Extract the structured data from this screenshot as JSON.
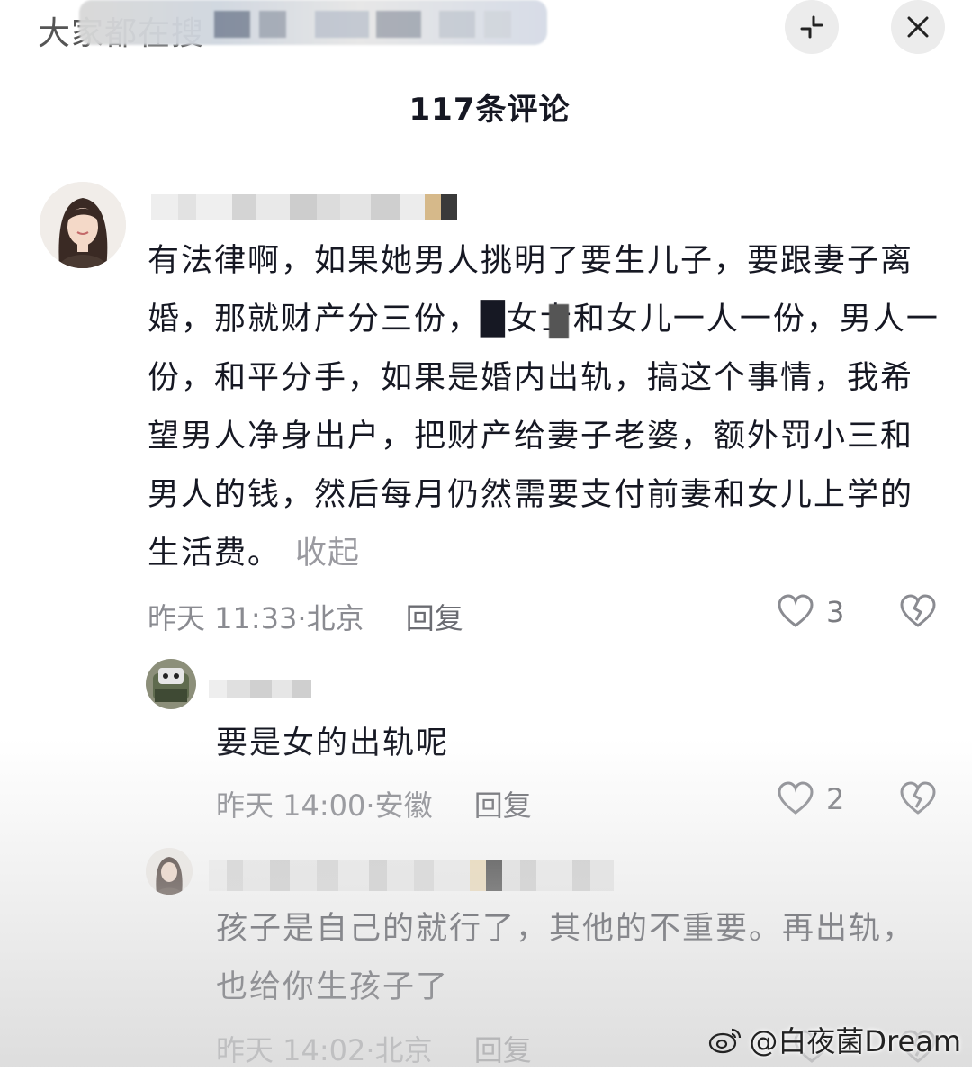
{
  "header": {
    "title_fragment": "大家都在搜",
    "comment_count": "117条评论",
    "icons": [
      "collapse-icon",
      "close-icon"
    ]
  },
  "comments": [
    {
      "text": "有法律啊，如果她男人挑明了要生儿子，要跟妻子离婚，那就财产分三份，█女士和女儿一人一份，男人一份，和平分手，如果是婚内出轨，搞这个事情，我希望男人净身出户，把财产给妻子老婆，额外罚小三和男人的钱，然后每月仍然需要支付前妻和女儿上学的生活费。",
      "collapse_label": "收起",
      "time": "昨天 11:33",
      "location": "北京",
      "reply_label": "回复",
      "likes": "3"
    },
    {
      "text": "要是女的出轨呢",
      "time": "昨天 14:00",
      "location": "安徽",
      "reply_label": "回复",
      "likes": "2"
    },
    {
      "text": "孩子是自己的就行了，其他的不重要。再出轨，也给你生孩子了",
      "time": "昨天 14:02",
      "location": "北京",
      "reply_label": "回复"
    }
  ],
  "watermark": "@白夜菌Dream",
  "colors": {
    "text": "#161823",
    "meta": "#8a8b91",
    "icon": "#9b9ca1"
  }
}
